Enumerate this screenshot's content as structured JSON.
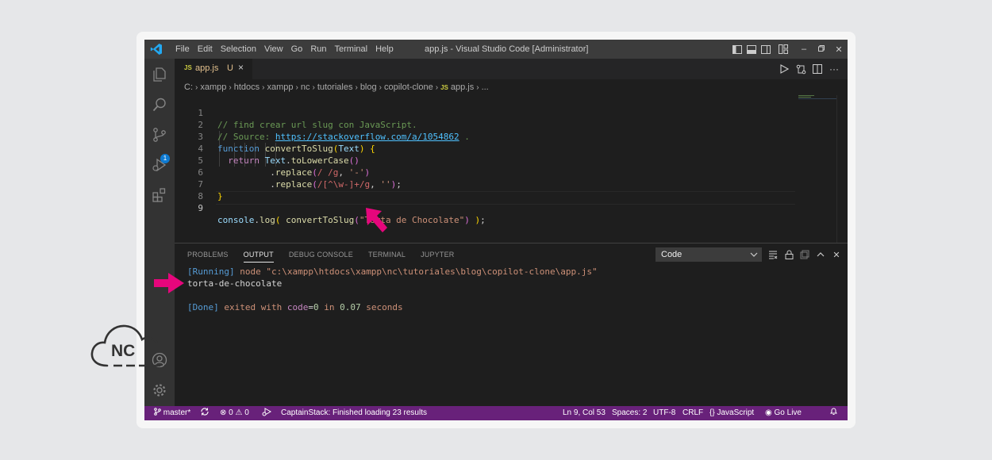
{
  "window": {
    "title": "app.js - Visual Studio Code [Administrator]",
    "menu": [
      "File",
      "Edit",
      "Selection",
      "View",
      "Go",
      "Run",
      "Terminal",
      "Help"
    ]
  },
  "tab": {
    "filetype": "JS",
    "label": "app.js",
    "status": "U",
    "close": "×"
  },
  "breadcrumb": {
    "segments": [
      "C:",
      "xampp",
      "htdocs",
      "xampp",
      "nc",
      "tutoriales",
      "blog",
      "copilot-clone"
    ],
    "filetype": "JS",
    "file": "app.js",
    "more": "..."
  },
  "code": {
    "line_numbers": [
      "1",
      "2",
      "3",
      "4",
      "5",
      "6",
      "7",
      "8",
      "9"
    ],
    "l1": "// find crear url slug con JavaScript.",
    "l2_prefix": "// Source: ",
    "l2_link": "https://stackoverflow.com/a/1054862",
    "l2_suffix": " .",
    "l3_kw": "function",
    "l3_fn": "convertToSlug",
    "l3_param": "Text",
    "l4_kw": "return",
    "l4_var": "Text",
    "l4_fn": "toLowerCase",
    "l5_fn": "replace",
    "l5_re": "/ /g",
    "l5_str": "'-'",
    "l6_fn": "replace",
    "l6_re": "/[^\\w-]+/g",
    "l6_str": "''",
    "l7": "}",
    "l9_obj": "console",
    "l9_fn": "log",
    "l9_call": "convertToSlug",
    "l9_str": "\"Torta de Chocolate\""
  },
  "panel": {
    "tabs": [
      "PROBLEMS",
      "OUTPUT",
      "DEBUG CONSOLE",
      "TERMINAL",
      "JUPYTER"
    ],
    "active_tab": "OUTPUT",
    "channel": "Code",
    "output": {
      "running_tag": "[Running]",
      "running_cmd": "node",
      "running_path": "\"c:\\xampp\\htdocs\\xampp\\nc\\tutoriales\\blog\\copilot-clone\\app.js\"",
      "result": "torta-de-chocolate",
      "done_tag": "[Done]",
      "done_text": "exited with",
      "done_code_kw": "code",
      "done_code_val": "0",
      "done_in": "in",
      "done_time": "0.07",
      "done_unit": "seconds"
    }
  },
  "status": {
    "branch": "master*",
    "errors": "0",
    "warnings": "0",
    "message": "CaptainStack: Finished loading 23 results",
    "position": "Ln 9, Col 53",
    "spaces": "Spaces: 2",
    "encoding": "UTF-8",
    "eol": "CRLF",
    "language": "JavaScript",
    "golive": "Go Live"
  },
  "activity": {
    "scm_badge": "1"
  },
  "logo": {
    "text": "NC"
  },
  "colors": {
    "status_bar": "#68217a",
    "accent_arrow": "#e6067c",
    "editor_bg": "#1e1e1e"
  }
}
